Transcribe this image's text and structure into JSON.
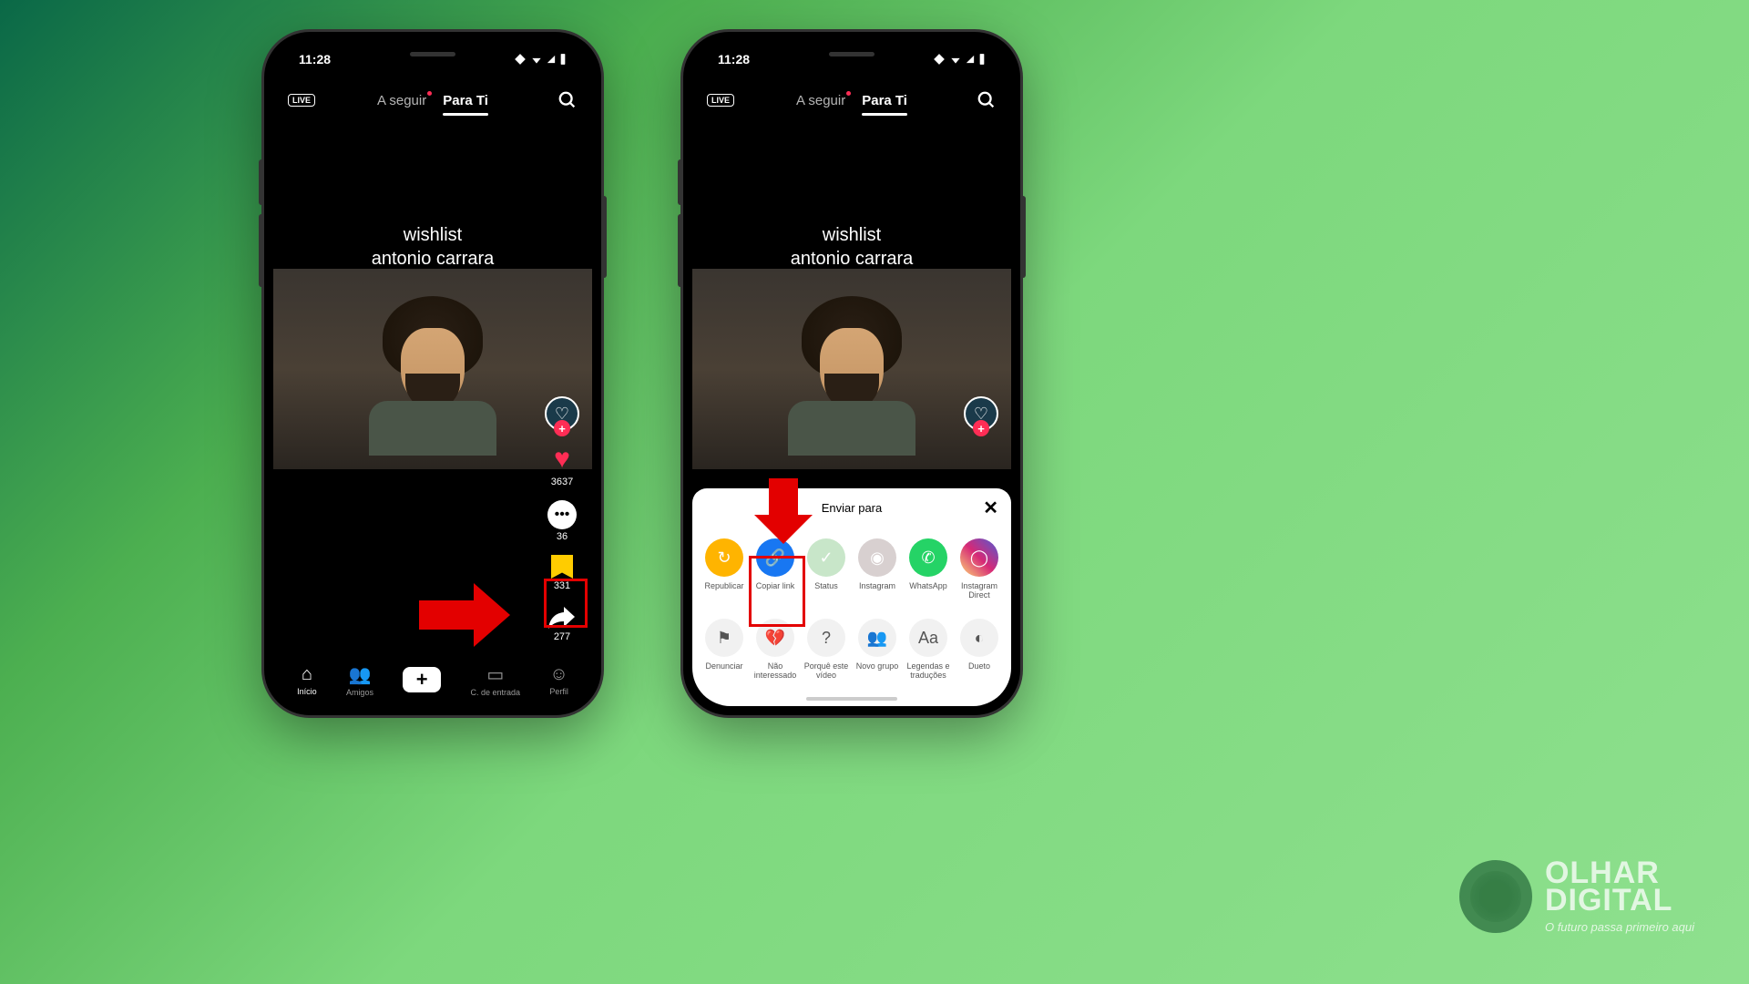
{
  "statusbar": {
    "time": "11:28"
  },
  "topbar": {
    "live": "LIVE",
    "tab_follow": "A seguir",
    "tab_foryou": "Para Ti"
  },
  "video": {
    "line1": "wishlist",
    "line2": "antonio carrara"
  },
  "counts": {
    "likes": "3637",
    "comments": "36",
    "bookmarks": "331",
    "shares": "277"
  },
  "nav": {
    "home": "Início",
    "friends": "Amigos",
    "inbox": "C. de entrada",
    "profile": "Perfil"
  },
  "sheet": {
    "title": "Enviar para",
    "share_options": [
      {
        "label": "Republicar",
        "color": "#ffb400",
        "glyph": "↻"
      },
      {
        "label": "Copiar link",
        "color": "#1877f2",
        "glyph": "🔗"
      },
      {
        "label": "Status",
        "color": "#c8e6c9",
        "glyph": "✓"
      },
      {
        "label": "Instagram",
        "color": "#d8d0d0",
        "glyph": "◉"
      },
      {
        "label": "WhatsApp",
        "color": "#25d366",
        "glyph": "✆"
      },
      {
        "label": "Instagram Direct",
        "color": "#e1306c",
        "glyph": "◯"
      }
    ],
    "actions": [
      {
        "label": "Denunciar",
        "glyph": "⚑"
      },
      {
        "label": "Não interessado",
        "glyph": "💔"
      },
      {
        "label": "Porquê este vídeo",
        "glyph": "?"
      },
      {
        "label": "Novo grupo",
        "glyph": "👥"
      },
      {
        "label": "Legendas e traduções",
        "glyph": "Aa"
      },
      {
        "label": "Dueto",
        "glyph": "◐"
      }
    ]
  },
  "brand": {
    "line1": "OLHAR",
    "line2": "DIGITAL",
    "tagline": "O futuro passa primeiro aqui"
  }
}
